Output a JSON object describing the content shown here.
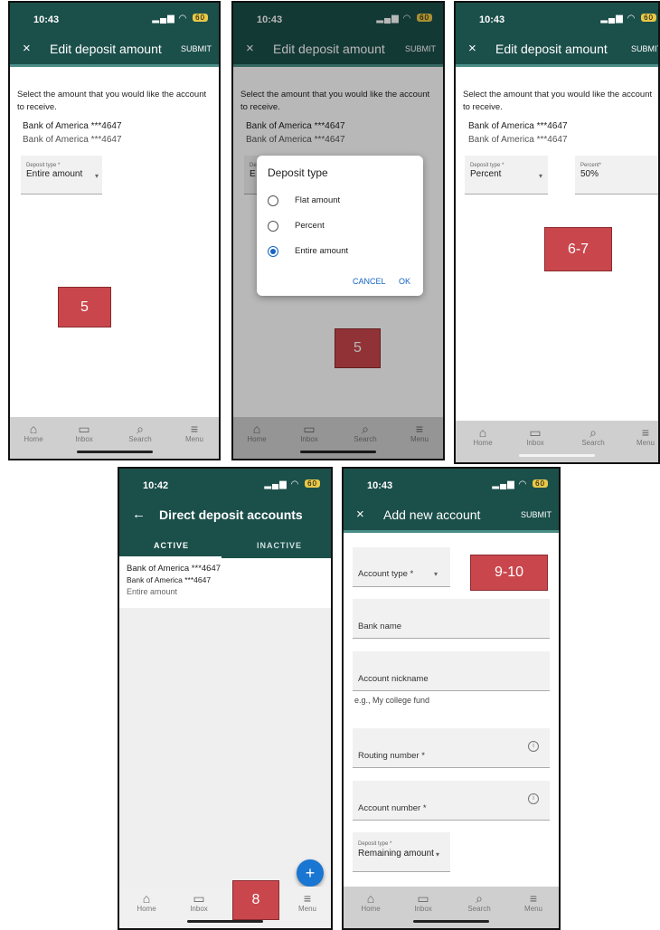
{
  "screens": {
    "edit1": {
      "time": "10:43",
      "battery": "60",
      "close_icon": "×",
      "title": "Edit deposit amount",
      "submit": "SUBMIT",
      "description": "Select the amount that you would like the account to receive.",
      "bank_line1": "Bank of America ***4647",
      "bank_line2": "Bank of America ***4647",
      "deposit_type_label": "Deposit type *",
      "deposit_type_value": "Entire amount",
      "step_label": "5"
    },
    "edit2": {
      "time": "10:43",
      "battery": "60",
      "close_icon": "×",
      "title": "Edit deposit amount",
      "submit": "SUBMIT",
      "description": "Select the amount that you would like the account to receive.",
      "bank_line1": "Bank of America ***4647",
      "bank_line2": "Bank of America ***4647",
      "field_label_partial": "De",
      "field_value_partial": "E",
      "dialog_title": "Deposit type",
      "options": [
        "Flat amount",
        "Percent",
        "Entire amount"
      ],
      "selected_option": "Entire amount",
      "cancel": "CANCEL",
      "ok": "OK",
      "step_label": "5"
    },
    "edit3": {
      "time": "10:43",
      "battery": "60",
      "close_icon": "×",
      "title": "Edit deposit amount",
      "submit": "SUBMIT",
      "description": "Select the amount that you would like the account to receive.",
      "bank_line1": "Bank of America ***4647",
      "bank_line2": "Bank of America ***4647",
      "deposit_type_label": "Deposit type *",
      "deposit_type_value": "Percent",
      "percent_label": "Percent*",
      "percent_value": "50%",
      "step_label": "6-7"
    },
    "accounts": {
      "time": "10:42",
      "battery": "60",
      "back_icon": "←",
      "title": "Direct deposit accounts",
      "tabs": [
        "ACTIVE",
        "INACTIVE"
      ],
      "active_tab": "ACTIVE",
      "bank_line1": "Bank of America ***4647",
      "bank_line2": "Bank of America ***4647",
      "amount": "Entire amount",
      "fab": "+",
      "step_label": "8"
    },
    "add": {
      "time": "10:43",
      "battery": "60",
      "close_icon": "×",
      "title": "Add new account",
      "submit": "SUBMIT",
      "account_type": "Account type *",
      "bank_name": "Bank name",
      "nickname": "Account nickname",
      "nickname_hint": "e.g., My college fund",
      "routing": "Routing number *",
      "account_number": "Account number *",
      "deposit_type_label": "Deposit type *",
      "deposit_type_value": "Remaining amount",
      "step_label": "9-10"
    }
  },
  "nav": [
    "Home",
    "Inbox",
    "Search",
    "Menu"
  ],
  "colors": {
    "appbar": "#1b4f4a",
    "accent": "#1565c0",
    "step_box": "#c9474c"
  }
}
